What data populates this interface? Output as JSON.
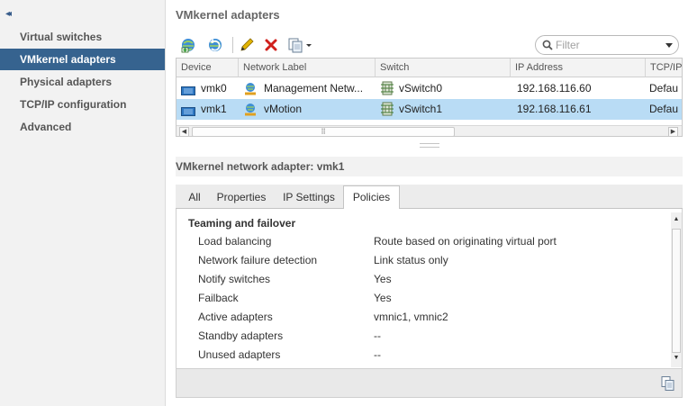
{
  "sidebar": {
    "collapse_glyph": "◂◂",
    "items": [
      {
        "label": "Virtual switches"
      },
      {
        "label": "VMkernel adapters",
        "active": true
      },
      {
        "label": "Physical adapters"
      },
      {
        "label": "TCP/IP configuration"
      },
      {
        "label": "Advanced"
      }
    ]
  },
  "main": {
    "title": "VMkernel adapters",
    "toolbar": {
      "icons": [
        "add-networking-icon",
        "refresh-icon",
        "edit-pencil-icon",
        "remove-x-icon",
        "copy-dropdown-icon"
      ]
    },
    "filter": {
      "placeholder": "Filter",
      "value": ""
    },
    "table": {
      "columns": [
        "Device",
        "Network Label",
        "Switch",
        "IP Address",
        "TCP/IP"
      ],
      "rows": [
        {
          "device": "vmk0",
          "label": "Management Netw...",
          "switch": "vSwitch0",
          "ip": "192.168.116.60",
          "tcpip": "Defau"
        },
        {
          "device": "vmk1",
          "label": "vMotion",
          "switch": "vSwitch1",
          "ip": "192.168.116.61",
          "tcpip": "Defau",
          "selected": true
        }
      ],
      "scroll_grip": "⠿"
    }
  },
  "details": {
    "title": "VMkernel network adapter: vmk1",
    "tabs": [
      "All",
      "Properties",
      "IP Settings",
      "Policies"
    ],
    "active_tab": "Policies",
    "section": "Teaming and failover",
    "properties": [
      {
        "label": "Load balancing",
        "value": "Route based on originating virtual port"
      },
      {
        "label": "Network failure detection",
        "value": "Link status only"
      },
      {
        "label": "Notify switches",
        "value": "Yes"
      },
      {
        "label": "Failback",
        "value": "Yes"
      },
      {
        "label": "Active adapters",
        "value": "vmnic1, vmnic2"
      },
      {
        "label": "Standby adapters",
        "value": "--"
      },
      {
        "label": "Unused adapters",
        "value": "--"
      }
    ]
  },
  "colors": {
    "nav_active": "#36638f",
    "row_selected": "#b9dcf5",
    "remove_red": "#d0201c",
    "edit_yellow": "#e2b400"
  }
}
